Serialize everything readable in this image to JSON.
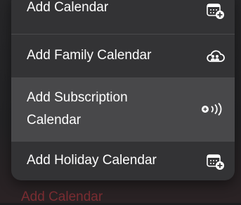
{
  "menu": {
    "items": [
      {
        "label": "Add Calendar",
        "icon": "calendar-add-icon"
      },
      {
        "label": "Add Family Calendar",
        "icon": "family-cloud-icon"
      },
      {
        "label": "Add Subscription Calendar",
        "icon": "subscription-broadcast-icon"
      },
      {
        "label": "Add Holiday Calendar",
        "icon": "calendar-add-icon"
      }
    ]
  },
  "background": {
    "label": "Add Calendar"
  },
  "colors": {
    "menu_bg": "#333335",
    "highlight_bg": "#48484a",
    "text": "#ffffff",
    "accent_red": "#8a2f35"
  }
}
